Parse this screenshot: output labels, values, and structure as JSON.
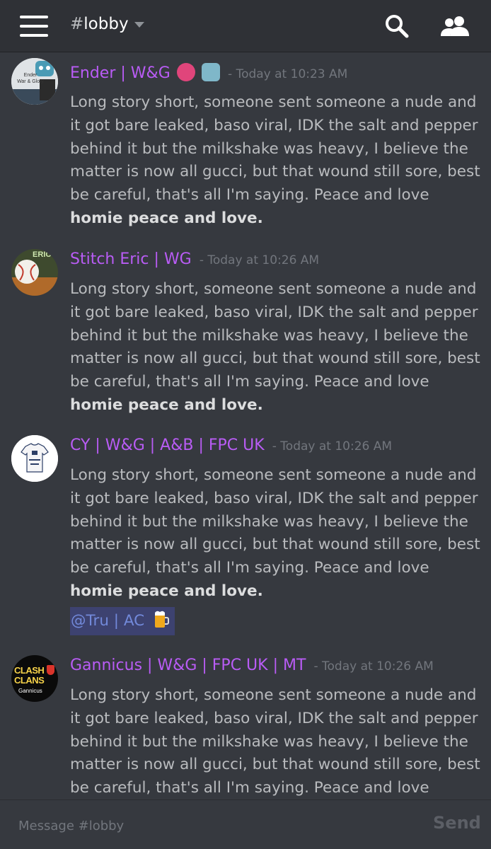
{
  "header": {
    "channel_hash": "#",
    "channel_name": "lobby"
  },
  "messages": [
    {
      "author": "Ender | W&G",
      "timestamp": "- Today at 10:23 AM",
      "avatar_text": "Ender\nWar & Glory",
      "author_emojis": [
        "octopus-emoji",
        "robot-emoji"
      ],
      "text": "Long story short, someone sent someone a nude and it got bare leaked, baso viral, IDK the salt and pepper behind it but the milkshake was heavy, I believe the matter is now all gucci, but that wound still sore, best be careful, that's all I'm saying. Peace and love ",
      "bold": "homie peace and love."
    },
    {
      "author": "Stitch Eric | WG",
      "timestamp": "- Today at 10:26 AM",
      "avatar_text": "ERIC",
      "text": "Long story short, someone sent someone a nude and it got bare leaked, baso viral, IDK the salt and pepper behind it but the milkshake was heavy, I believe the matter is now all gucci, but that wound still sore, best be careful, that's all I'm saying. Peace and love ",
      "bold": "homie peace and love."
    },
    {
      "author": "CY | W&G | A&B | FPC UK",
      "timestamp": "- Today at 10:26 AM",
      "text": "Long story short, someone sent someone a nude and it got bare leaked, baso viral, IDK the salt and pepper behind it but the milkshake was heavy, I believe the matter is now all gucci, but that wound still sore, best be careful, that's all I'm saying. Peace and love ",
      "bold": "homie peace and love.",
      "mention": "@Tru | AC"
    },
    {
      "author": "Gannicus | W&G | FPC UK | MT",
      "timestamp": "- Today at 10:26 AM",
      "avatar_text_1": "CLASH",
      "avatar_text_2": "CLANS",
      "avatar_text_3": "Gannicus",
      "text": "Long story short, someone sent someone a nude and it got bare leaked, baso viral, IDK the salt and pepper behind it but the milkshake was heavy, I believe the matter is now all gucci, but that wound still sore, best be careful, that's all I'm saying. Peace and love homie"
    }
  ],
  "composer": {
    "placeholder": "Message #lobby",
    "send_label": "Send"
  },
  "colors": {
    "background": "#36393f",
    "header": "#2f3136",
    "author": "#b95cf5",
    "mention_bg": "#3d4270",
    "mention_text": "#7289da"
  }
}
